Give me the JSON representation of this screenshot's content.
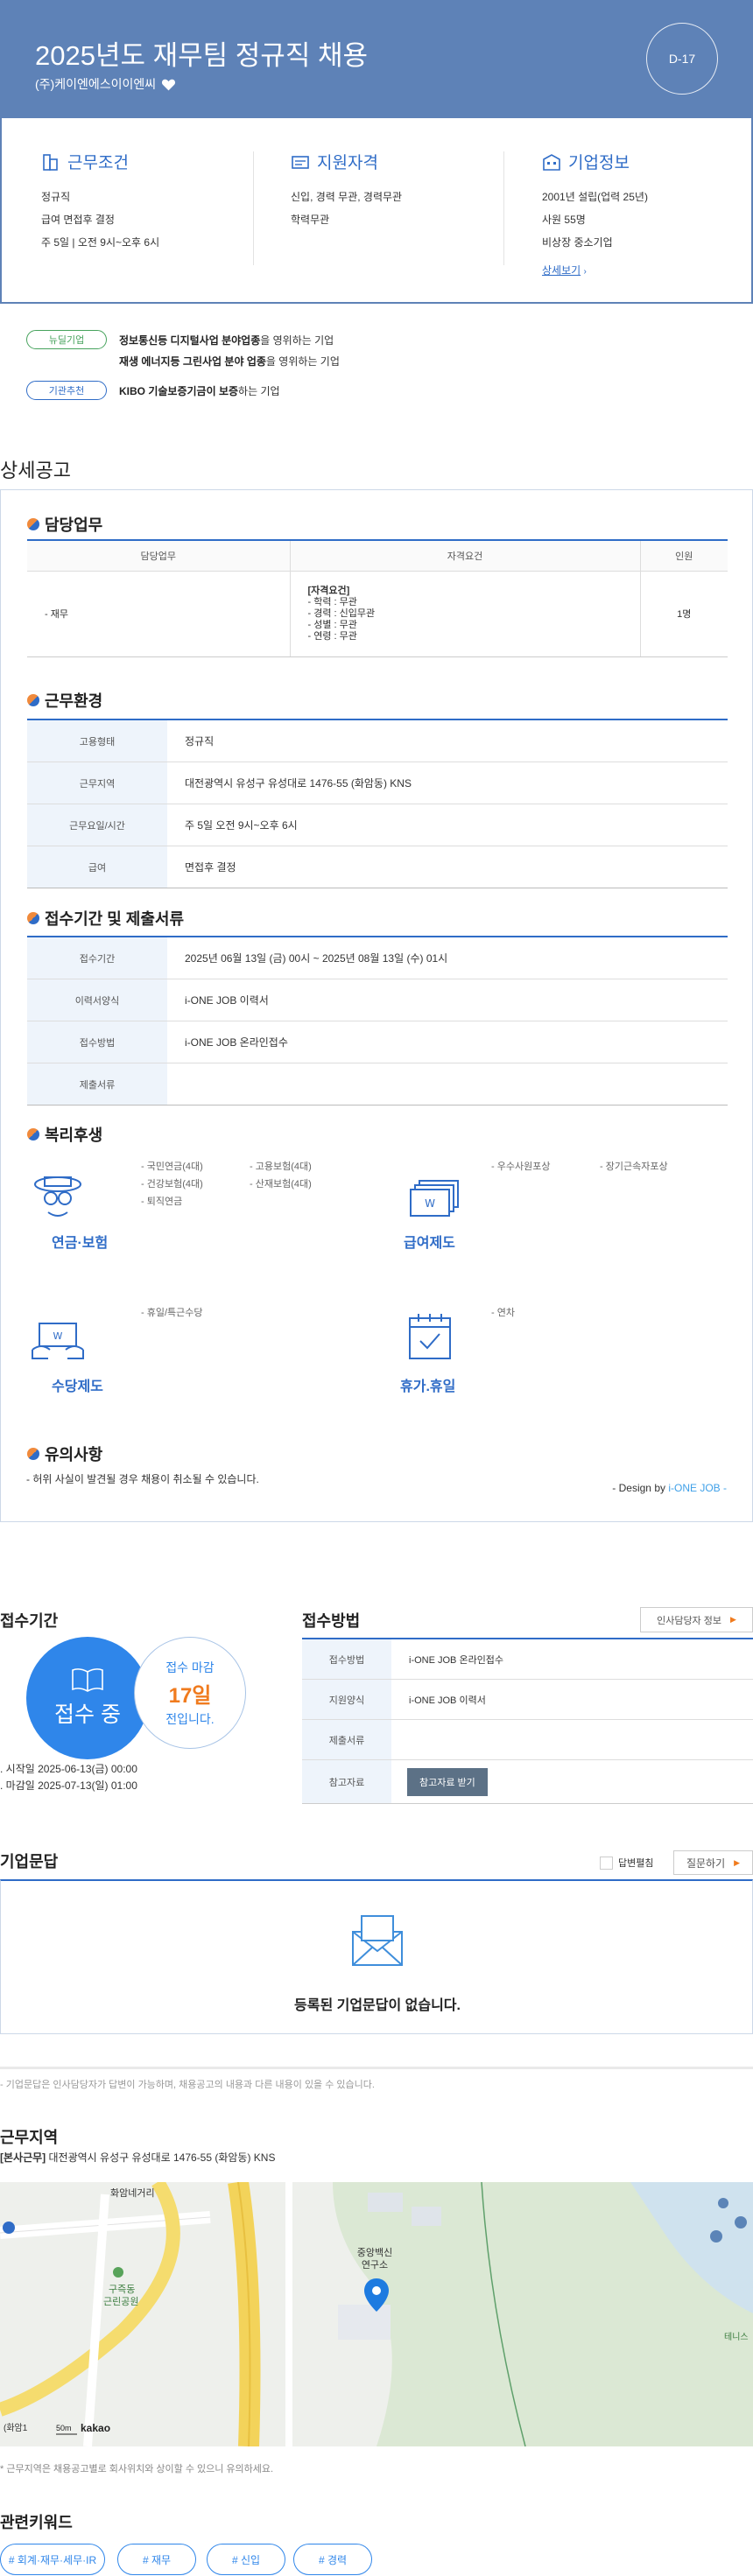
{
  "header": {
    "title": "2025년도 재무팀 정규직 채용",
    "company": "(주)케이엔에스이이엔씨",
    "dday": "D-17"
  },
  "summary": {
    "conditions": {
      "heading": "근무조건",
      "lines": [
        "정규직",
        "급여 면접후 결정",
        "주 5일 | 오전 9시~오후 6시"
      ]
    },
    "qualification": {
      "heading": "지원자격",
      "lines": [
        "신입, 경력 무관, 경력무관",
        "학력무관"
      ]
    },
    "company": {
      "heading": "기업정보",
      "lines": [
        "2001년 설립(업력 25년)",
        "사원 55명",
        "비상장 중소기업"
      ],
      "link": "상세보기"
    }
  },
  "badges": [
    {
      "label": "뉴딜기업",
      "lines": [
        {
          "bold": "정보통신등 디지털사업 분야업종",
          "rest": "을 영위하는 기업"
        },
        {
          "bold": "재생 에너지등 그린사업 분야 업종",
          "rest": "을 영위하는 기업"
        }
      ]
    },
    {
      "label": "기관추천",
      "lines": [
        {
          "bold": "KIBO 기술보증기금이 보증",
          "rest": "하는 기업"
        }
      ]
    }
  ],
  "detail": {
    "section_title": "상세공고",
    "duty": {
      "heading": "담당업무",
      "cols": [
        "담당업무",
        "자격요건",
        "인원"
      ],
      "task": "- 재무",
      "req_title": "[자격요건]",
      "req": [
        "- 학력 : 무관",
        "- 경력 : 신입무관",
        "- 성별 : 무관",
        "- 연령 : 무관"
      ],
      "count": "1명"
    },
    "env": {
      "heading": "근무환경",
      "rows": [
        {
          "k": "고용형태",
          "v": "정규직"
        },
        {
          "k": "근무지역",
          "v": "대전광역시 유성구 유성대로 1476-55 (화암동) KNS"
        },
        {
          "k": "근무요일/시간",
          "v": "주 5일 오전 9시~오후 6시"
        },
        {
          "k": "급여",
          "v": "면접후 결정"
        }
      ]
    },
    "period": {
      "heading": "접수기간 및 제출서류",
      "rows": [
        {
          "k": "접수기간",
          "v": "2025년 06월 13일 (금) 00시 ~ 2025년 08월 13일 (수) 01시"
        },
        {
          "k": "이력서양식",
          "v": "i-ONE JOB 이력서"
        },
        {
          "k": "접수방법",
          "v": "i-ONE JOB 온라인접수"
        },
        {
          "k": "제출서류",
          "v": ""
        }
      ]
    },
    "welfare": {
      "heading": "복리후생",
      "items": [
        {
          "name": "연금·보험",
          "icon": "pension-icon",
          "col1": [
            "- 국민연금(4대)",
            "- 건강보험(4대)",
            "- 퇴직연금"
          ],
          "col2": [
            "- 고용보험(4대)",
            "- 산재보험(4대)"
          ]
        },
        {
          "name": "급여제도",
          "icon": "salary-icon",
          "col1": [
            "- 우수사원포상"
          ],
          "col2": [
            "- 장기근속자포상"
          ]
        },
        {
          "name": "수당제도",
          "icon": "allowance-icon",
          "col1": [
            "- 휴일/특근수당"
          ],
          "col2": []
        },
        {
          "name": "휴가.휴일",
          "icon": "calendar-icon",
          "col1": [
            "- 연차"
          ],
          "col2": []
        }
      ]
    },
    "caution": {
      "heading": "유의사항",
      "text": "- 허위 사실이 발견될 경우 채용이 취소될 수 있습니다."
    },
    "design_prefix": "- Design by ",
    "design_brand": "i-ONE JOB -"
  },
  "apply": {
    "title": "접수기간",
    "status": "접수 중",
    "deadline_label": "접수 마감",
    "days": "17일",
    "days_suffix": "전입니다.",
    "start": "시작일 2025-06-13(금) 00:00",
    "end": "마감일 2025-07-13(일) 01:00"
  },
  "method": {
    "title": "접수방법",
    "hr_button": "인사담당자 정보",
    "rows": [
      {
        "k": "접수방법",
        "v": "i-ONE JOB 온라인접수"
      },
      {
        "k": "지원양식",
        "v": "i-ONE JOB 이력서"
      },
      {
        "k": "제출서류",
        "v": ""
      },
      {
        "k": "참고자료",
        "v": ""
      }
    ],
    "ref_button": "참고자료 받기"
  },
  "qna": {
    "title": "기업문답",
    "check_label": "답변펼침",
    "ask_button": "질문하기",
    "empty": "등록된 기업문답이 없습니다.",
    "note": "- 기업문답은 인사담당자가 답변이 가능하며, 채용공고의 내용과 다른 내용이 있을 수 있습니다."
  },
  "location": {
    "title": "근무지역",
    "addr_tag": "[본사근무]",
    "addr": " 대전광역시 유성구 유성대로 1476-55 (화암동) KNS",
    "map_labels": {
      "crossroad": "화암네거리",
      "park1": "구즉동",
      "park2": "근린공원",
      "research1": "중앙백신",
      "research2": "연구소",
      "side": "테니스",
      "scale": "50m",
      "brand": "kakao",
      "corner": "(화암1"
    },
    "note": "* 근무지역은 채용공고별로 회사위치와 상이할 수 있으니 유의하세요."
  },
  "keywords": {
    "title": "관련키워드",
    "items": [
      "# 회계·재무·세무·IR",
      "# 재무",
      "# 신입",
      "# 경력"
    ]
  }
}
